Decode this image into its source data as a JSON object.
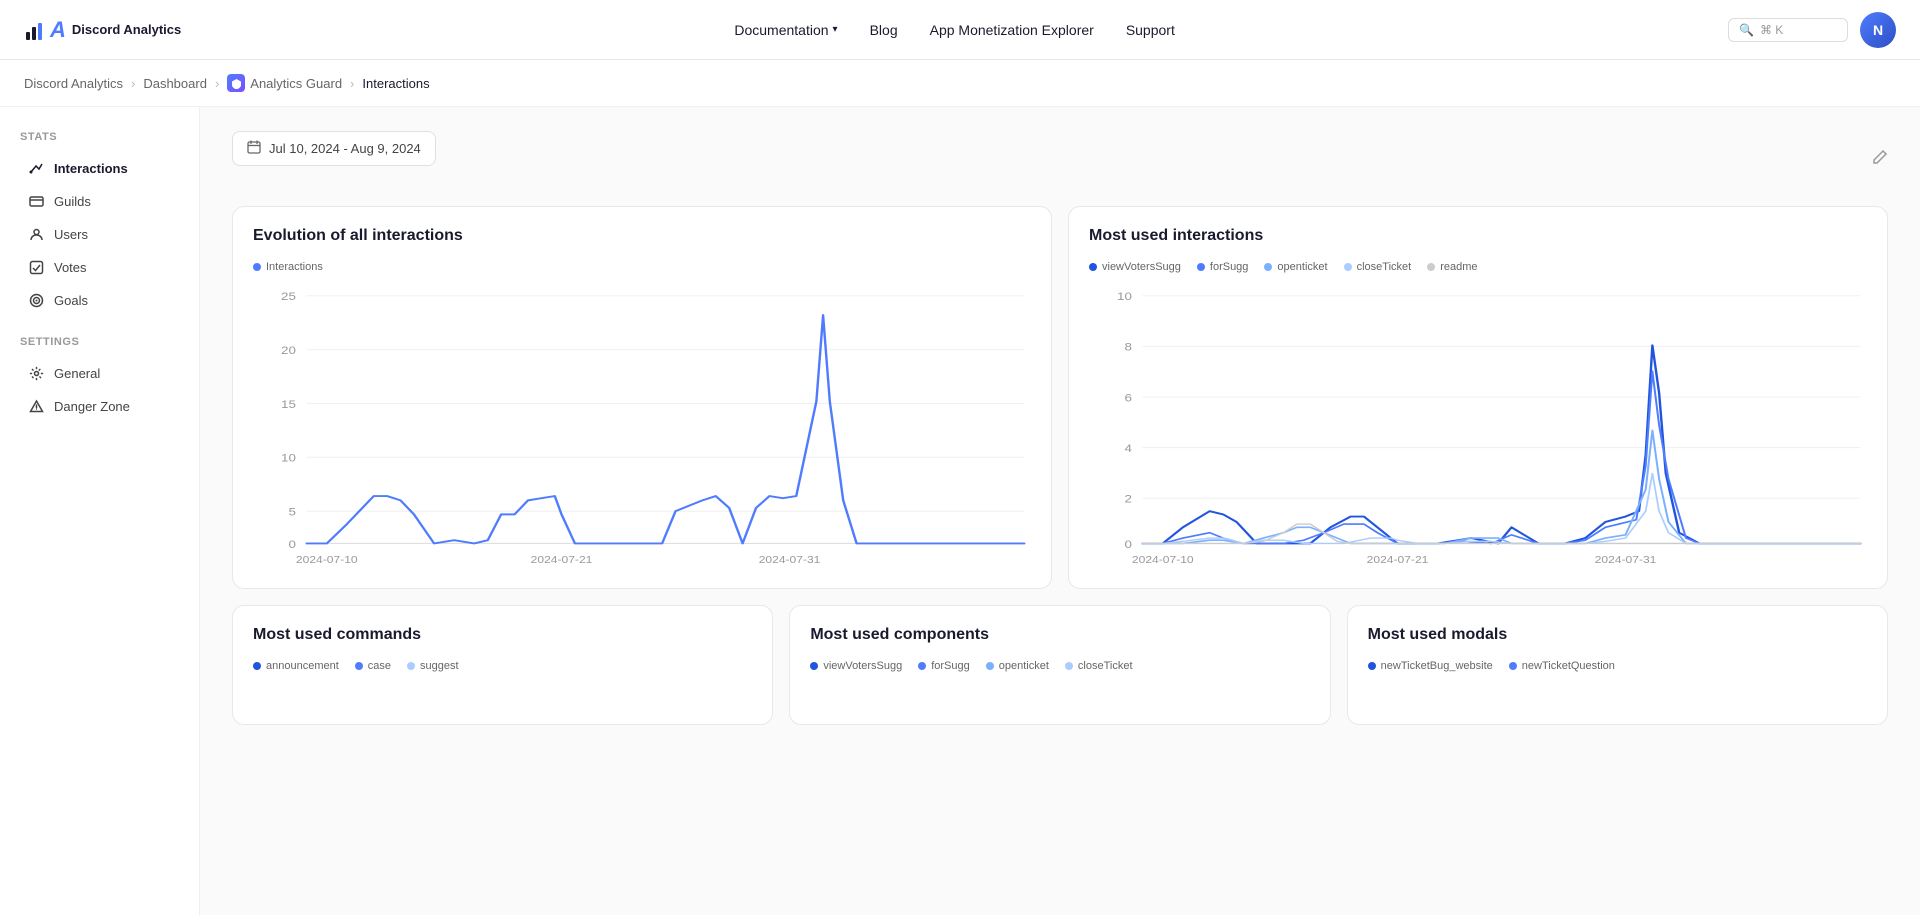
{
  "header": {
    "logo_text": "Discord Analytics",
    "logo_letters": "DA",
    "nav": [
      {
        "label": "Documentation",
        "has_dropdown": true
      },
      {
        "label": "Blog"
      },
      {
        "label": "App Monetization Explorer"
      },
      {
        "label": "Support"
      }
    ],
    "search_placeholder": "⌘ K",
    "avatar_initials": "N"
  },
  "breadcrumb": {
    "items": [
      {
        "label": "Discord Analytics",
        "link": true
      },
      {
        "label": "Dashboard",
        "link": true
      },
      {
        "label": "Analytics Guard",
        "link": true,
        "has_icon": true
      },
      {
        "label": "Interactions",
        "current": true
      }
    ]
  },
  "sidebar": {
    "stats_label": "Stats",
    "stats_items": [
      {
        "label": "Interactions",
        "active": true,
        "icon": "interactions"
      },
      {
        "label": "Guilds",
        "icon": "guilds"
      },
      {
        "label": "Users",
        "icon": "users"
      },
      {
        "label": "Votes",
        "icon": "votes"
      },
      {
        "label": "Goals",
        "icon": "goals"
      }
    ],
    "settings_label": "Settings",
    "settings_items": [
      {
        "label": "General",
        "icon": "gear"
      },
      {
        "label": "Danger Zone",
        "icon": "triangle"
      }
    ]
  },
  "content": {
    "date_range": "Jul 10, 2024 - Aug 9, 2024",
    "chart1": {
      "title": "Evolution of all interactions",
      "legend": [
        {
          "label": "Interactions",
          "color": "#4f7cff"
        }
      ],
      "y_labels": [
        "25",
        "20",
        "15",
        "10",
        "5",
        "0"
      ],
      "x_labels": [
        "2024-07-10",
        "2024-07-21",
        "2024-07-31"
      ]
    },
    "chart2": {
      "title": "Most used interactions",
      "legend": [
        {
          "label": "viewVotersSugg",
          "color": "#2255dd"
        },
        {
          "label": "forSugg",
          "color": "#4f7cff"
        },
        {
          "label": "openticket",
          "color": "#7ab0ff"
        },
        {
          "label": "closeTicket",
          "color": "#aaccff"
        },
        {
          "label": "readme",
          "color": "#dddddd"
        }
      ],
      "y_labels": [
        "10",
        "8",
        "6",
        "4",
        "2",
        "0"
      ],
      "x_labels": [
        "2024-07-10",
        "2024-07-21",
        "2024-07-31"
      ]
    },
    "bottom_charts": [
      {
        "title": "Most used commands",
        "legend_items": [
          "announcement",
          "case",
          "suggest"
        ]
      },
      {
        "title": "Most used components",
        "legend_items": [
          "viewVotersSugg",
          "forSugg",
          "openticket",
          "closeTicket"
        ]
      },
      {
        "title": "Most used modals",
        "legend_items": [
          "newTicketBug_website",
          "newTicketQuestion"
        ]
      }
    ]
  }
}
